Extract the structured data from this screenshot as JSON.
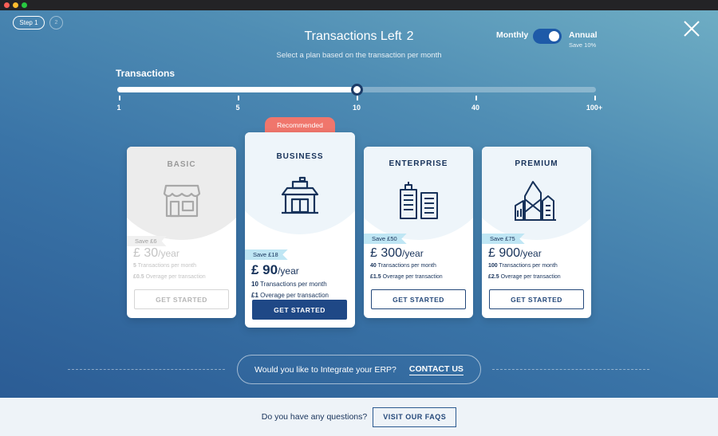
{
  "header": {
    "step_label": "Step 1",
    "step2_label": "2",
    "title": "Transactions Left",
    "transactions_left": "2",
    "subtitle": "Select a plan based on the transaction per month",
    "billing": {
      "monthly_label": "Monthly",
      "annual_label": "Annual",
      "annual_save": "Save 10%",
      "annual_selected": true
    }
  },
  "slider": {
    "label": "Transactions",
    "ticks": [
      "1",
      "5",
      "10",
      "40",
      "100+"
    ],
    "selected_value": "10"
  },
  "recommended_label": "Recommended",
  "plans": [
    {
      "name": "BASIC",
      "save": "Save £6",
      "price": "£ 30",
      "period": "/year",
      "tx_count": "5",
      "tx_text": "Transactions per month",
      "overage": "£0.5",
      "overage_text": "Overage per transaction",
      "button": "GET STARTED",
      "state": "disabled"
    },
    {
      "name": "BUSINESS",
      "save": "Save £18",
      "price": "£ 90",
      "period": "/year",
      "tx_count": "10",
      "tx_text": "Transactions per month",
      "overage": "£1",
      "overage_text": "Overage per transaction",
      "button": "GET STARTED",
      "state": "recommended"
    },
    {
      "name": "ENTERPRISE",
      "save": "Save £50",
      "price": "£ 300",
      "period": "/year",
      "tx_count": "40",
      "tx_text": "Transactions per month",
      "overage": "£1.5",
      "overage_text": "Overage per transaction",
      "button": "GET STARTED",
      "state": "normal"
    },
    {
      "name": "PREMIUM",
      "save": "Save £75",
      "price": "£ 900",
      "period": "/year",
      "tx_count": "100",
      "tx_text": "Transactions per month",
      "overage": "£2.5",
      "overage_text": "Overage per transaction",
      "button": "GET STARTED",
      "state": "normal"
    }
  ],
  "erp": {
    "question": "Would you like to Integrate your ERP?",
    "link": "CONTACT US"
  },
  "footer": {
    "question": "Do you have any questions?",
    "button": "VISIT OUR FAQS"
  },
  "icons": [
    "close-icon",
    "shop-icon",
    "bank-icon",
    "office-buildings-icon",
    "skyscrapers-icon"
  ],
  "colors": {
    "primary": "#1f4886",
    "accent": "#f0766c",
    "ribbon": "#bfe6f4",
    "text": "#17325a"
  }
}
